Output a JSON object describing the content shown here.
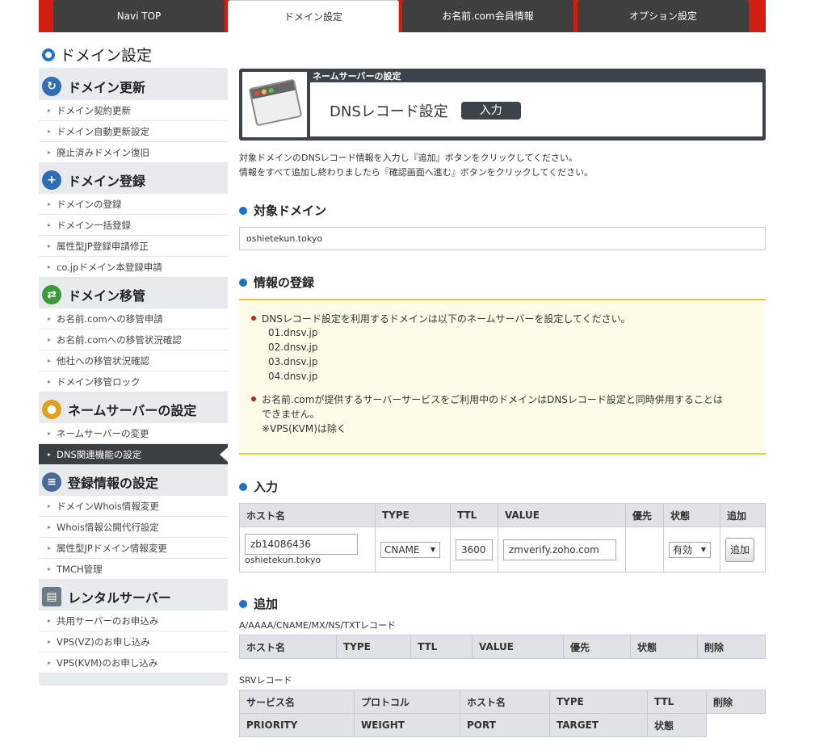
{
  "topnav": {
    "tabs": [
      {
        "label": "Navi TOP"
      },
      {
        "label": "ドメイン設定"
      },
      {
        "label": "お名前.com会員情報"
      },
      {
        "label": "オプション設定"
      }
    ]
  },
  "page_title": "ドメイン設定",
  "sidebar": {
    "sections": [
      {
        "title": "ドメイン更新",
        "items": [
          "ドメイン契約更新",
          "ドメイン自動更新設定",
          "廃止済みドメイン復旧"
        ]
      },
      {
        "title": "ドメイン登録",
        "items": [
          "ドメインの登録",
          "ドメイン一括登録",
          "属性型JP登録申請修正",
          "co.jpドメイン本登録申請"
        ]
      },
      {
        "title": "ドメイン移管",
        "items": [
          "お名前.comへの移管申請",
          "お名前.comへの移管状況確認",
          "他社への移管状況確認",
          "ドメイン移管ロック"
        ]
      },
      {
        "title": "ネームサーバーの設定",
        "items": [
          "ネームサーバーの変更",
          "DNS関連機能の設定"
        ]
      },
      {
        "title": "登録情報の設定",
        "items": [
          "ドメインWhois情報変更",
          "Whois情報公開代行設定",
          "属性型JPドメイン情報変更",
          "TMCH管理"
        ]
      },
      {
        "title": "レンタルサーバー",
        "items": [
          "共用サーバーのお申込み",
          "VPS(VZ)のお申し込み",
          "VPS(KVM)のお申し込み"
        ]
      }
    ]
  },
  "panel": {
    "breadcrumb": "ネームサーバーの設定",
    "title": "DNSレコード設定",
    "badge": "入力"
  },
  "instructions": [
    "対象ドメインのDNSレコード情報を入力し『追加』ボタンをクリックしてください。",
    "情報をすべて追加し終わりましたら『確認画面へ進む』ボタンをクリックしてください。"
  ],
  "target_domain": {
    "heading": "対象ドメイン",
    "value": "oshietekun.tokyo"
  },
  "registration": {
    "heading": "情報の登録",
    "note1": "DNSレコード設定を利用するドメインは以下のネームサーバーを設定してください。",
    "nameservers": [
      "01.dnsv.jp",
      "02.dnsv.jp",
      "03.dnsv.jp",
      "04.dnsv.jp"
    ],
    "note2a": "お名前.comが提供するサーバーサービスをご利用中のドメインはDNSレコード設定と同時併用することは",
    "note2b": "できません。",
    "note2c": "※VPS(KVM)は除く"
  },
  "input": {
    "heading": "入力",
    "headers": [
      "ホスト名",
      "TYPE",
      "TTL",
      "VALUE",
      "優先",
      "状態",
      "追加"
    ],
    "host": "zb14086436",
    "domain_suffix": "oshietekun.tokyo",
    "type": "CNAME",
    "ttl": "3600",
    "value": "zmverify.zoho.com",
    "status": "有効",
    "add_button": "追加"
  },
  "added": {
    "heading": "追加",
    "caption1": "A/AAAA/CNAME/MX/NS/TXTレコード",
    "headers1": [
      "ホスト名",
      "TYPE",
      "TTL",
      "VALUE",
      "優先",
      "状態",
      "削除"
    ],
    "caption2": "SRVレコード",
    "headers2a": [
      "サービス名",
      "プロトコル",
      "ホスト名",
      "TYPE",
      "TTL",
      "削除"
    ],
    "headers2b": [
      "PRIORITY",
      "WEIGHT",
      "PORT",
      "TARGET",
      "状態"
    ]
  },
  "colors": {
    "accent": "#1a72c9",
    "nav_red": "#d21d0f",
    "dark": "#3c444b",
    "notice_border": "#f3c640"
  }
}
